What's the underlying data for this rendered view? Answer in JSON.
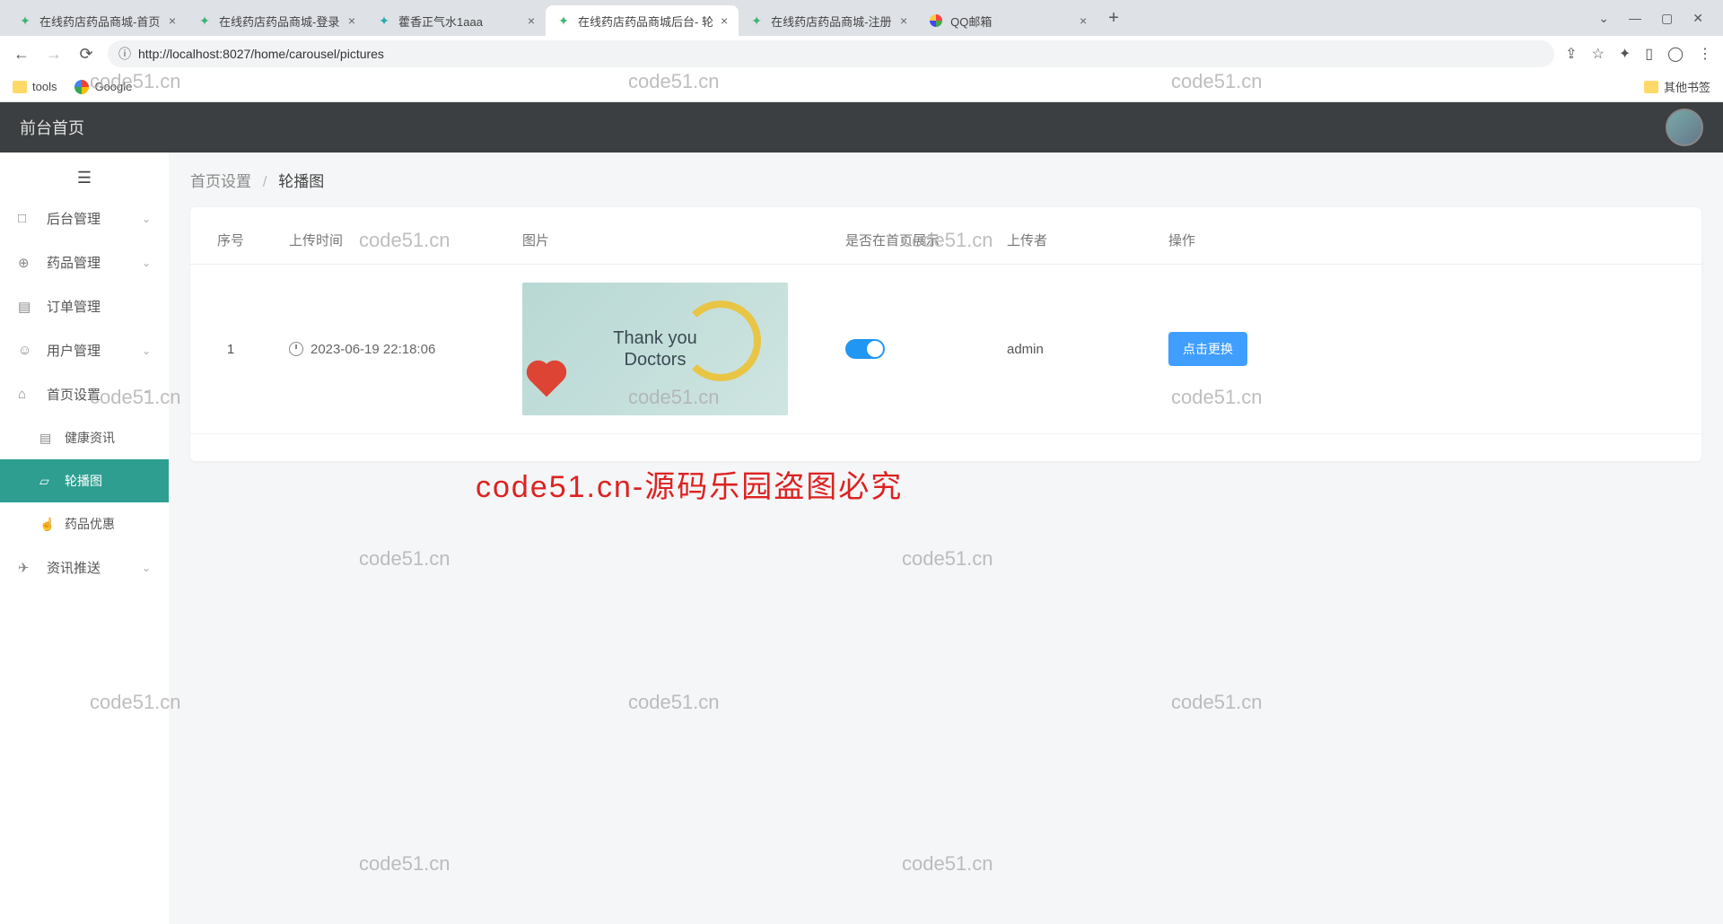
{
  "browser": {
    "tabs": [
      {
        "title": "在线药店药品商城-首页",
        "favicon": "green"
      },
      {
        "title": "在线药店药品商城-登录",
        "favicon": "green"
      },
      {
        "title": "藿香正气水1aaa",
        "favicon": "teal"
      },
      {
        "title": "在线药店药品商城后台- 轮",
        "favicon": "green",
        "active": true
      },
      {
        "title": "在线药店药品商城-注册",
        "favicon": "green"
      },
      {
        "title": "QQ邮箱",
        "favicon": "multi"
      }
    ],
    "url": "http://localhost:8027/home/carousel/pictures",
    "bookmarks": {
      "tools": "tools",
      "google": "Google",
      "other": "其他书签"
    }
  },
  "header": {
    "title": "前台首页"
  },
  "sidebar": {
    "items": [
      {
        "label": "后台管理",
        "icon": "□",
        "chevron": "›"
      },
      {
        "label": "药品管理",
        "icon": "⊕",
        "chevron": "›"
      },
      {
        "label": "订单管理",
        "icon": "▤",
        "chevron": ""
      },
      {
        "label": "用户管理",
        "icon": "☺",
        "chevron": "›"
      },
      {
        "label": "首页设置",
        "icon": "⌂",
        "chevron": "‹",
        "expanded": true,
        "children": [
          {
            "label": "健康资讯",
            "icon": "▤"
          },
          {
            "label": "轮播图",
            "icon": "▱",
            "active": true
          },
          {
            "label": "药品优惠",
            "icon": "☝"
          }
        ]
      },
      {
        "label": "资讯推送",
        "icon": "✈",
        "chevron": "›"
      }
    ]
  },
  "breadcrumb": {
    "parent": "首页设置",
    "current": "轮播图"
  },
  "table": {
    "headers": {
      "index": "序号",
      "time": "上传时间",
      "image": "图片",
      "show": "是否在首页展示",
      "uploader": "上传者",
      "action": "操作"
    },
    "rows": [
      {
        "index": "1",
        "time": "2023-06-19 22:18:06",
        "thumb_line1": "Thank you",
        "thumb_line2": "Doctors",
        "show_on": true,
        "uploader": "admin",
        "action_label": "点击更换"
      }
    ]
  },
  "watermarks": {
    "text": "code51.cn",
    "red": "code51.cn-源码乐园盗图必究"
  }
}
